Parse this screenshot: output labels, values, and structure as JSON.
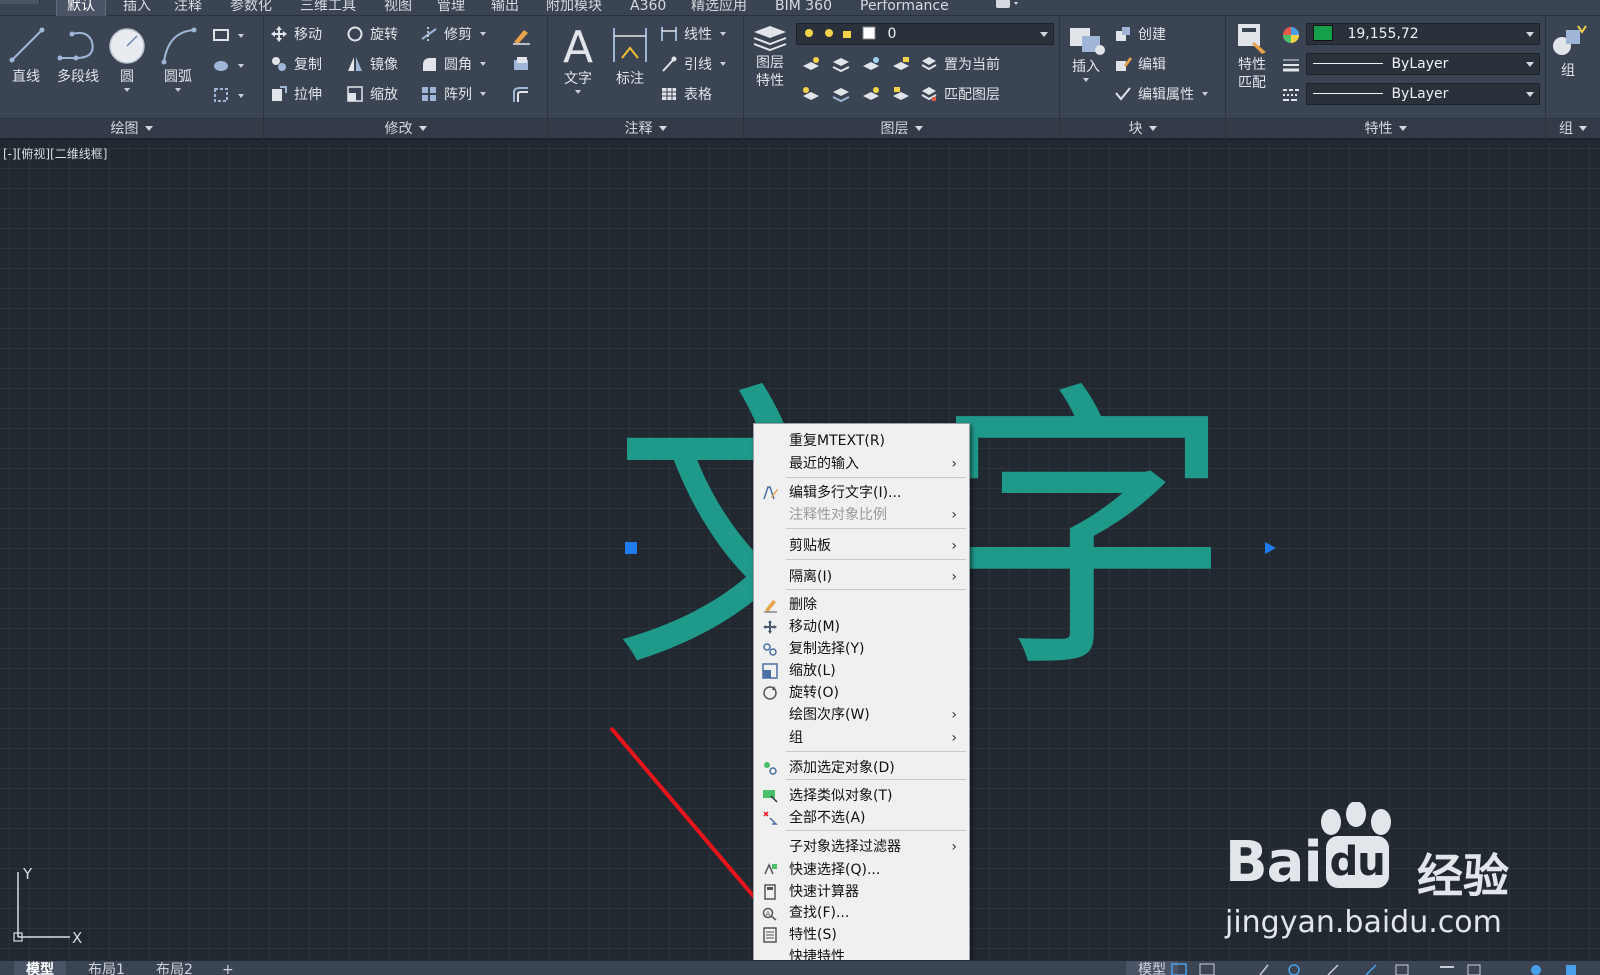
{
  "ribbon_tabs": [
    "默认",
    "插入",
    "注释",
    "参数化",
    "三维工具",
    "视图",
    "管理",
    "输出",
    "附加模块",
    "A360",
    "精选应用",
    "BIM 360",
    "Performance"
  ],
  "panels": {
    "draw": {
      "title": "绘图",
      "line": "直线",
      "polyline": "多段线",
      "circle": "圆",
      "arc": "圆弧"
    },
    "modify": {
      "title": "修改",
      "move": "移动",
      "rotate": "旋转",
      "trim": "修剪",
      "copy": "复制",
      "mirror": "镜像",
      "fillet": "圆角",
      "stretch": "拉伸",
      "scale": "缩放",
      "array": "阵列"
    },
    "annotation": {
      "title": "注释",
      "text": "文字",
      "dimension": "标注",
      "linear": "线性",
      "leader": "引线",
      "table": "表格"
    },
    "layers": {
      "title": "图层",
      "layer_properties_line1": "图层",
      "layer_properties_line2": "特性",
      "current_layer": "0",
      "make_current": "置为当前",
      "match_layer": "匹配图层"
    },
    "block": {
      "title": "块",
      "insert": "插入",
      "create": "创建",
      "edit": "编辑",
      "edit_attributes": "编辑属性"
    },
    "properties": {
      "title": "特性",
      "match_line1": "特性",
      "match_line2": "匹配",
      "color_value": "19,155,72",
      "color_swatch": "#13a048",
      "linetype": "ByLayer",
      "lineweight": "ByLayer"
    },
    "groups": {
      "title": "组",
      "group": "组"
    }
  },
  "viewport": {
    "label": "[-][俯视][二维线框]"
  },
  "drawing": {
    "mtext": "文字",
    "text_color": "#1f9a8a"
  },
  "context_menu": {
    "items": [
      {
        "label": "重复MTEXT(R)",
        "submenu": false,
        "disabled": false,
        "icon": ""
      },
      {
        "label": "最近的输入",
        "submenu": true,
        "disabled": false,
        "icon": ""
      },
      {
        "label": "编辑多行文字(I)...",
        "submenu": false,
        "disabled": false,
        "icon": "edit-text-icon"
      },
      {
        "label": "注释性对象比例",
        "submenu": true,
        "disabled": true,
        "icon": ""
      },
      {
        "label": "剪贴板",
        "submenu": true,
        "disabled": false,
        "icon": ""
      },
      {
        "label": "隔离(I)",
        "submenu": true,
        "disabled": false,
        "icon": ""
      },
      {
        "label": "删除",
        "submenu": false,
        "disabled": false,
        "icon": "erase-icon"
      },
      {
        "label": "移动(M)",
        "submenu": false,
        "disabled": false,
        "icon": "move-icon"
      },
      {
        "label": "复制选择(Y)",
        "submenu": false,
        "disabled": false,
        "icon": "copy-icon"
      },
      {
        "label": "缩放(L)",
        "submenu": false,
        "disabled": false,
        "icon": "scale-icon"
      },
      {
        "label": "旋转(O)",
        "submenu": false,
        "disabled": false,
        "icon": "rotate-icon"
      },
      {
        "label": "绘图次序(W)",
        "submenu": true,
        "disabled": false,
        "icon": ""
      },
      {
        "label": "组",
        "submenu": true,
        "disabled": false,
        "icon": ""
      },
      {
        "label": "添加选定对象(D)",
        "submenu": false,
        "disabled": false,
        "icon": "add-selected-icon"
      },
      {
        "label": "选择类似对象(T)",
        "submenu": false,
        "disabled": false,
        "icon": "select-similar-icon"
      },
      {
        "label": "全部不选(A)",
        "submenu": false,
        "disabled": false,
        "icon": "deselect-all-icon"
      },
      {
        "label": "子对象选择过滤器",
        "submenu": true,
        "disabled": false,
        "icon": ""
      },
      {
        "label": "快速选择(Q)...",
        "submenu": false,
        "disabled": false,
        "icon": "quick-select-icon"
      },
      {
        "label": "快速计算器",
        "submenu": false,
        "disabled": false,
        "icon": "calculator-icon"
      },
      {
        "label": "查找(F)...",
        "submenu": false,
        "disabled": false,
        "icon": "find-icon"
      },
      {
        "label": "特性(S)",
        "submenu": false,
        "disabled": false,
        "icon": "properties-icon"
      },
      {
        "label": "快捷特性",
        "submenu": false,
        "disabled": false,
        "icon": ""
      }
    ]
  },
  "watermark": {
    "brand": "Bai",
    "paw_suffix": "du",
    "cn": "经验",
    "url": "jingyan.baidu.com"
  },
  "bottom_tabs": [
    "模型",
    "布局1",
    "布局2",
    "+"
  ],
  "status": {
    "model_label": "模型"
  },
  "ucs": {
    "x": "X",
    "y": "Y"
  }
}
